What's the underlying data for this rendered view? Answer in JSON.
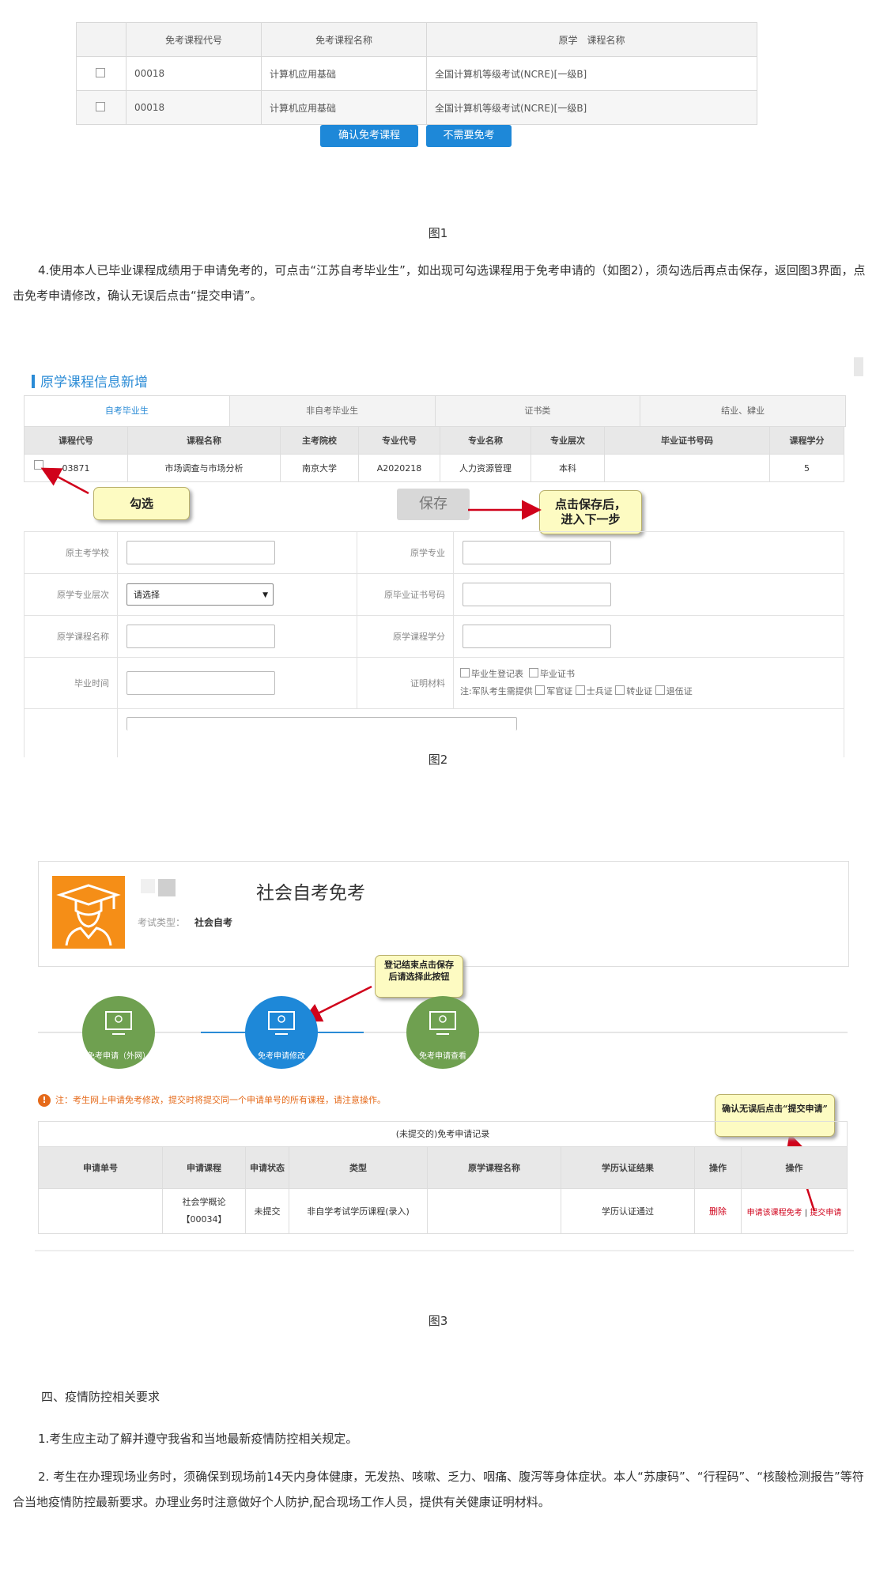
{
  "fig1": {
    "headers": [
      "",
      "免考课程代号",
      "免考课程名称",
      "原学　课程名称"
    ],
    "rows": [
      {
        "code": "00018",
        "name": "计算机应用基础",
        "orig": "全国计算机等级考试(NCRE)[一级B]"
      },
      {
        "code": "00018",
        "name": "计算机应用基础",
        "orig": "全国计算机等级考试(NCRE)[一级B]"
      }
    ],
    "confirm_button": "确认免考课程",
    "no_need_button": "不需要免考",
    "caption": "图1"
  },
  "para4": "4.使用本人已毕业课程成绩用于申请免考的，可点击“江苏自考毕业生”，如出现可勾选课程用于免考申请的（如图2），须勾选后再点击保存，返回图3界面，点击免考申请修改，确认无误后点击“提交申请”。",
  "fig2": {
    "section_title": "原学课程信息新增",
    "tabs": [
      "自考毕业生",
      "非自考毕业生",
      "证书类",
      "结业、肄业"
    ],
    "headers": [
      "课程代号",
      "课程名称",
      "主考院校",
      "专业代号",
      "专业名称",
      "专业层次",
      "毕业证书号码",
      "课程学分"
    ],
    "row": {
      "code": "03871",
      "name": "市场调查与市场分析",
      "school": "南京大学",
      "major_code": "A2020218",
      "major": "人力资源管理",
      "level": "本科",
      "cert": "",
      "credit": "5"
    },
    "callout_check": "勾选",
    "save_button": "保存",
    "callout_save_line1": "点击保存后，",
    "callout_save_line2": "进入下一步",
    "form": {
      "orig_school": "原主考学校",
      "orig_major": "原学专业",
      "orig_level": "原学专业层次",
      "level_select": "请选择",
      "orig_cert_no": "原毕业证书号码",
      "orig_course": "原学课程名称",
      "orig_credit": "原学课程学分",
      "grad_time": "毕业时间",
      "proof": "证明材料",
      "proof_options": [
        "毕业生登记表",
        "毕业证书"
      ],
      "military_note": "注:军队考生需提供",
      "military_options": [
        "军官证",
        "士兵证",
        "转业证",
        "退伍证"
      ]
    },
    "caption": "图2"
  },
  "fig3": {
    "title": "社会自考免考",
    "exam_type_label": "考试类型：",
    "exam_type_value": "社会自考",
    "callout_modify": "登记结束点击保存后请选择此按钮",
    "steps": [
      "免考申请（外网）",
      "免考申请修改",
      "免考申请查看"
    ],
    "notice": "注：考生网上申请免考修改，提交时将提交同一个申请单号的所有课程，请注意操作。",
    "callout_submit": "确认无误后点击“提交申请”",
    "table_title": "(未提交的)免考申请记录",
    "headers": [
      "申请单号",
      "申请课程",
      "申请状态",
      "类型",
      "原学课程名称",
      "学历认证结果",
      "操作",
      "操作"
    ],
    "row": {
      "no": "",
      "course_line1": "社会学概论",
      "course_line2": "【00034】",
      "status": "未提交",
      "type": "非自学考试学历课程(录入)",
      "orig_name": "",
      "result": "学历认证通过",
      "delete": "删除",
      "apply_exempt": "申请该课程免考",
      "sep": "|",
      "submit": "提交申请"
    },
    "caption": "图3"
  },
  "section4": {
    "title": "四、疫情防控相关要求",
    "p1": "1.考生应主动了解并遵守我省和当地最新疫情防控相关规定。",
    "p2": "2. 考生在办理现场业务时，须确保到现场前14天内身体健康，无发热、咳嗽、乏力、咽痛、腹泻等身体症状。本人“苏康码”、“行程码”、“核酸检测报告”等符合当地疫情防控最新要求。办理业务时注意做好个人防护,配合现场工作人员，提供有关健康证明材料。"
  },
  "colors": {
    "blue": "#1e88d8",
    "green": "#6fa050",
    "orange": "#f58e17",
    "red": "#d0021b"
  }
}
